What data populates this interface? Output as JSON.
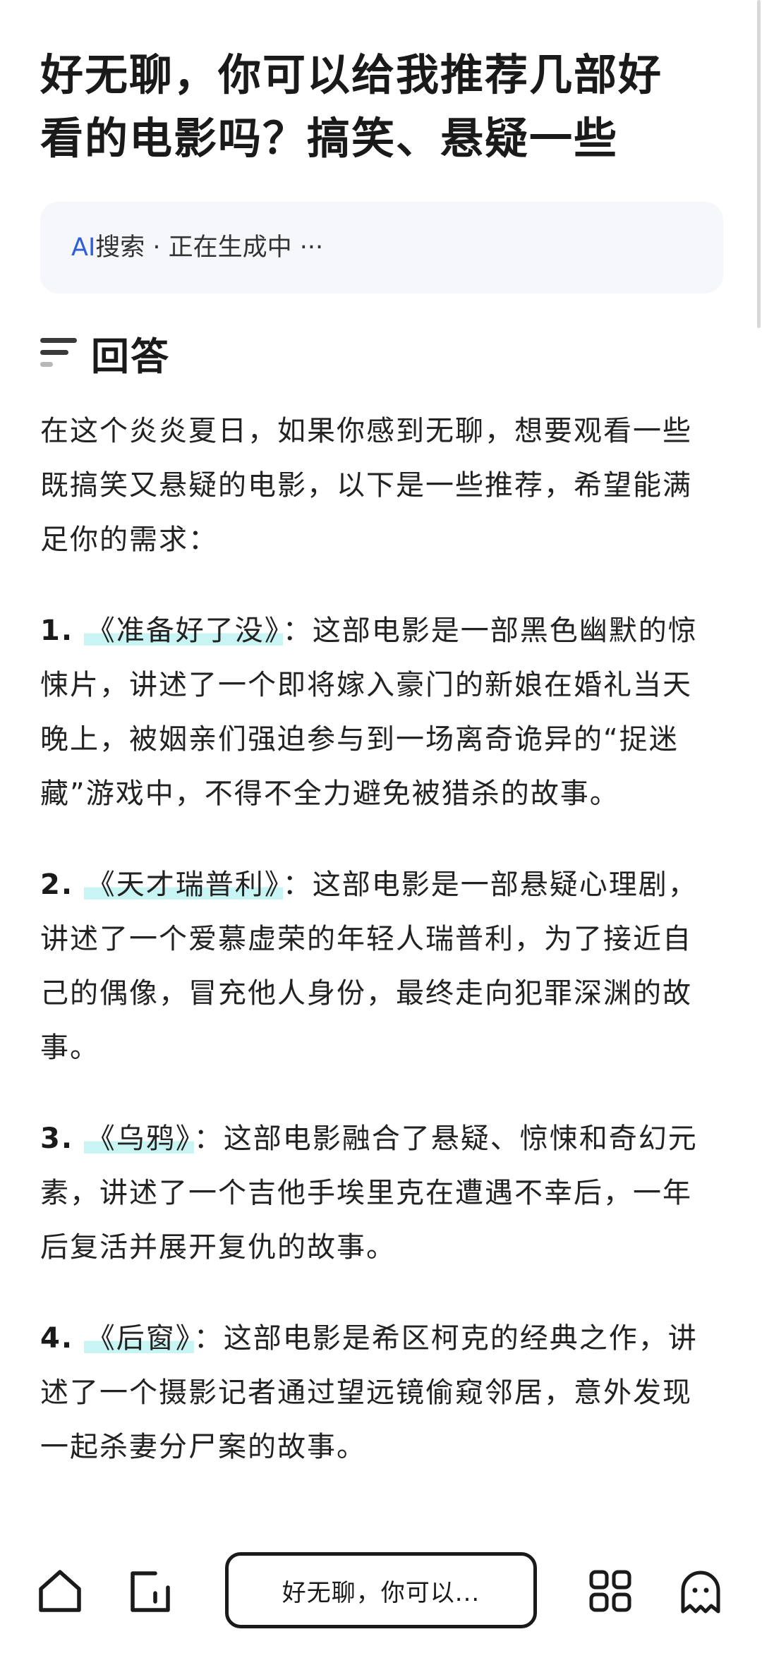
{
  "question": {
    "line1": "好无聊，你可以给我推荐几部好",
    "line2": "看的电影吗？搞笑、悬疑一些"
  },
  "status": {
    "ai": "AI",
    "search": "搜索",
    "sep": " · ",
    "generating": "正在生成中 ···"
  },
  "answer": {
    "title": "回答",
    "intro": "在这个炎炎夏日，如果你感到无聊，想要观看一些既搞笑又悬疑的电影，以下是一些推荐，希望能满足你的需求：",
    "items": [
      {
        "num": "1.",
        "title": "《准备好了没》",
        "desc": "：这部电影是一部黑色幽默的惊悚片，讲述了一个即将嫁入豪门的新娘在婚礼当天晚上，被姻亲们强迫参与到一场离奇诡异的“捉迷藏”游戏中，不得不全力避免被猎杀的故事。"
      },
      {
        "num": "2.",
        "title": "《天才瑞普利》",
        "desc": "：这部电影是一部悬疑心理剧，讲述了一个爱慕虚荣的年轻人瑞普利，为了接近自己的偶像，冒充他人身份，最终走向犯罪深渊的故事。"
      },
      {
        "num": "3.",
        "title": "《乌鸦》",
        "desc": "：这部电影融合了悬疑、惊悚和奇幻元素，讲述了一个吉他手埃里克在遭遇不幸后，一年后复活并展开复仇的故事。"
      },
      {
        "num": "4.",
        "title": "《后窗》",
        "desc": "：这部电影是希区柯克的经典之作，讲述了一个摄影记者通过望远镜偷窥邻居，意外发现一起杀妻分尸案的故事。"
      }
    ]
  },
  "bottom_bar": {
    "input_text": "好无聊，你可以...",
    "icons": [
      "home-icon",
      "note-icon",
      "apps-icon",
      "ghost-icon"
    ]
  },
  "colors": {
    "accent_ai": "#2f5ed9",
    "highlight": "#c8f4f3",
    "status_bg": "#f5f7fb"
  }
}
